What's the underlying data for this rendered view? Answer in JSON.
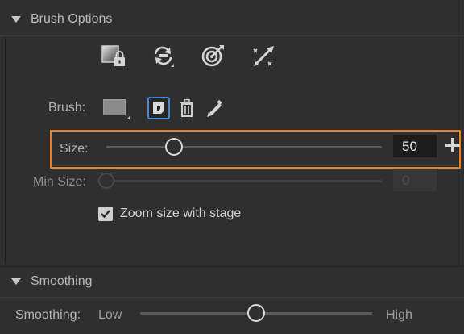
{
  "brush_options": {
    "title": "Brush Options",
    "tools": [
      {
        "icon": "lock-fill-icon"
      },
      {
        "icon": "rotate-brush-icon"
      },
      {
        "icon": "pressure-target-icon"
      },
      {
        "icon": "tilt-pen-icon"
      }
    ],
    "brush_label": "Brush:",
    "brush_shapes": [
      "shape-swatch-icon",
      "shape-corner-icon"
    ],
    "size_label": "Size:",
    "size_value": "50",
    "size_level": 0.24,
    "min_size_label": "Min Size:",
    "min_size_value": "0",
    "min_size_level": 0.0,
    "zoom_label": "Zoom size with stage",
    "zoom_checked": true
  },
  "smoothing": {
    "title": "Smoothing",
    "label": "Smoothing:",
    "low": "Low",
    "high": "High",
    "level": 0.5
  },
  "colors": {
    "accent_highlight": "#e5822e",
    "selected": "#3e8bd8"
  }
}
